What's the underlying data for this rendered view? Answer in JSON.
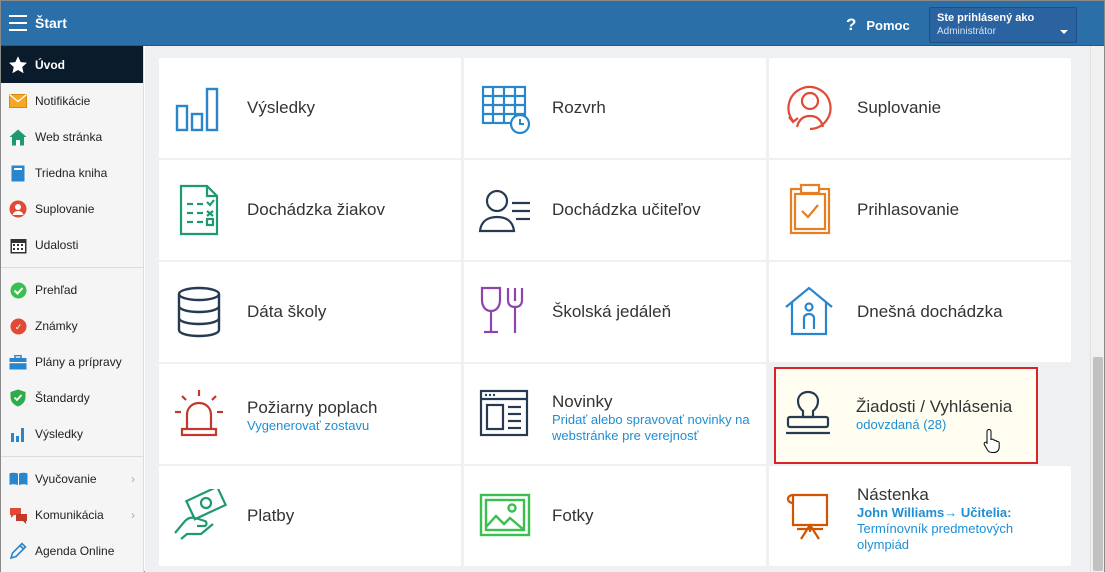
{
  "header": {
    "title": "Štart",
    "help_label": "Pomoc",
    "user_line1": "Ste prihlásený ako",
    "user_line2": "Administrátor"
  },
  "sidebar": {
    "items": [
      {
        "label": "Úvod",
        "icon": "star-icon"
      },
      {
        "label": "Notifikácie",
        "icon": "envelope-icon"
      },
      {
        "label": "Web stránka",
        "icon": "house-icon"
      },
      {
        "label": "Triedna kniha",
        "icon": "book-icon"
      },
      {
        "label": "Suplovanie",
        "icon": "person-icon"
      },
      {
        "label": "Udalosti",
        "icon": "calendar-icon"
      },
      {
        "label": "Prehľad",
        "icon": "check-circle-icon"
      },
      {
        "label": "Známky",
        "icon": "grade-icon"
      },
      {
        "label": "Plány a prípravy",
        "icon": "briefcase-icon"
      },
      {
        "label": "Štandardy",
        "icon": "shield-icon"
      },
      {
        "label": "Výsledky",
        "icon": "bar-chart-icon"
      },
      {
        "label": "Vyučovanie",
        "icon": "open-book-icon"
      },
      {
        "label": "Komunikácia",
        "icon": "chat-icon"
      },
      {
        "label": "Agenda Online",
        "icon": "pen-icon"
      }
    ]
  },
  "tiles": {
    "vysledky": {
      "label": "Výsledky"
    },
    "rozvrh": {
      "label": "Rozvrh"
    },
    "suplovanie": {
      "label": "Suplovanie"
    },
    "dochadzka_ziakov": {
      "label": "Dochádzka žiakov"
    },
    "dochadzka_ucitelov": {
      "label": "Dochádzka učiteľov"
    },
    "prihlasovanie": {
      "label": "Prihlasovanie"
    },
    "data_skoly": {
      "label": "Dáta školy"
    },
    "jedalen": {
      "label": "Školská jedáleň"
    },
    "dnesna_dochadzka": {
      "label": "Dnešná dochádzka"
    },
    "poziarny_poplach": {
      "label": "Požiarny poplach",
      "sub": "Vygenerovať zostavu"
    },
    "novinky": {
      "label": "Novinky",
      "sub": "Pridať alebo spravovať novinky na webstránke pre verejnosť"
    },
    "ziadosti": {
      "label": "Žiadosti / Vyhlásenia",
      "sub": "odovzdaná (28)"
    },
    "platby": {
      "label": "Platby"
    },
    "fotky": {
      "label": "Fotky"
    },
    "nastenka": {
      "label": "Nástenka",
      "author": "John Williams→ Učitelia:",
      "sub": "Termínovník predmetových olympiád"
    }
  },
  "colors": {
    "header_bg": "#2b6fa8",
    "active_sidebar_bg": "#0a1b2c",
    "link_blue": "#1e8fd5",
    "highlight_border": "#d8232a"
  }
}
